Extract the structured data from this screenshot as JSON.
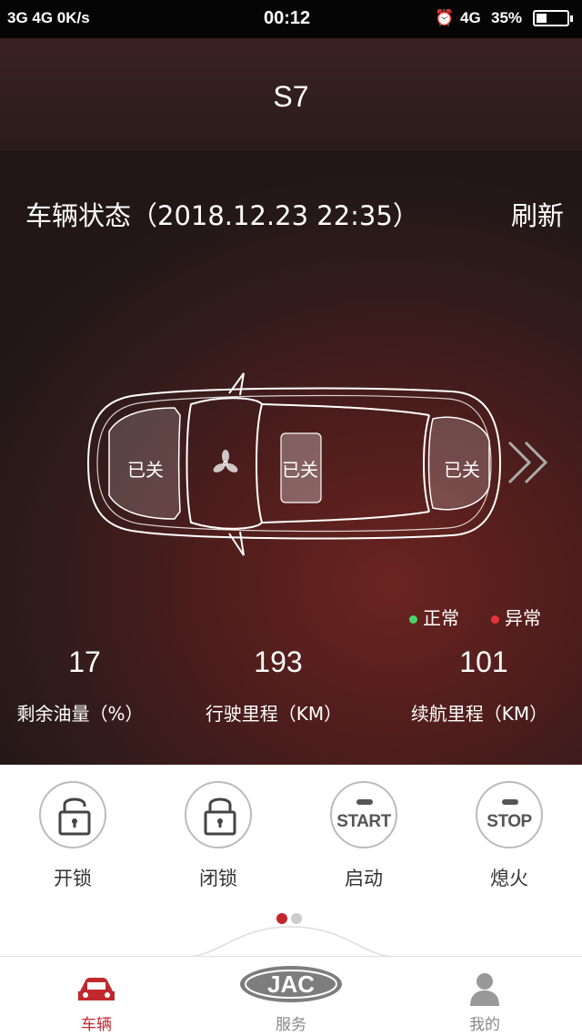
{
  "status_bar": {
    "left": "3G  4G  0K/s",
    "time": "00:12",
    "network": "4G",
    "battery": "35%",
    "battery_level": 0.35
  },
  "header": {
    "title": "S7"
  },
  "vehicle_status": {
    "title": "车辆状态（2018.12.23 22:35）",
    "refresh_label": "刷新",
    "doors": {
      "front": "已关",
      "sunroof": "已关",
      "trunk": "已关"
    }
  },
  "legend": {
    "normal": "正常",
    "abnormal": "异常",
    "normal_color": "#4cd26b",
    "abnormal_color": "#e8333a"
  },
  "stats": [
    {
      "value": "17",
      "label": "剩余油量（%）"
    },
    {
      "value": "193",
      "label": "行驶里程（KM）"
    },
    {
      "value": "101",
      "label": "续航里程（KM）"
    }
  ],
  "controls": [
    {
      "label": "开锁",
      "icon": "unlock-icon"
    },
    {
      "label": "闭锁",
      "icon": "lock-icon"
    },
    {
      "label": "启动",
      "icon_text": "START"
    },
    {
      "label": "熄火",
      "icon_text": "STOP"
    }
  ],
  "tabs": [
    {
      "label": "车辆",
      "active": true
    },
    {
      "label": "服务",
      "logo": "JAC"
    },
    {
      "label": "我的"
    }
  ],
  "accent_color": "#c0282d"
}
